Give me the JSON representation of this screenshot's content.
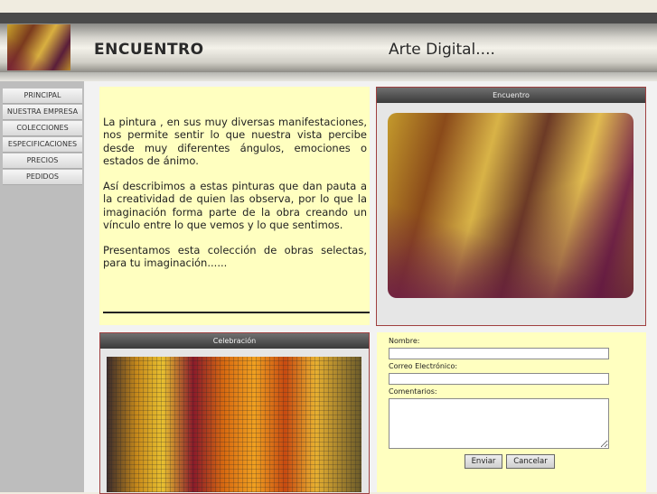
{
  "header": {
    "title": "ENCUENTRO",
    "tagline": "Arte Digital...."
  },
  "menu": [
    {
      "label": "PRINCIPAL"
    },
    {
      "label": "NUESTRA EMPRESA"
    },
    {
      "label": "COLECCIONES"
    },
    {
      "label": "ESPECIFICACIONES"
    },
    {
      "label": "PRECIOS"
    },
    {
      "label": "PEDIDOS"
    }
  ],
  "intro": {
    "p1": "La pintura , en sus muy diversas manifestaciones, nos permite sentir lo que nuestra vista percibe desde muy diferentes ángulos, emociones o estados de ánimo.",
    "p2": "Así describimos a estas pinturas que dan pauta a la creatividad de quien las observa, por lo que la imaginación forma parte de la obra creando un vínculo entre lo que vemos y lo que sentimos.",
    "p3": "Presentamos esta colección de obras selectas, para tu imaginación......"
  },
  "panels": {
    "encuentro_title": "Encuentro",
    "celebracion_title": "Celebración"
  },
  "form": {
    "name_label": "Nombre:",
    "email_label": "Correo Electrónico:",
    "comments_label": "Comentarios:",
    "send_label": "Enviar",
    "cancel_label": "Cancelar"
  }
}
